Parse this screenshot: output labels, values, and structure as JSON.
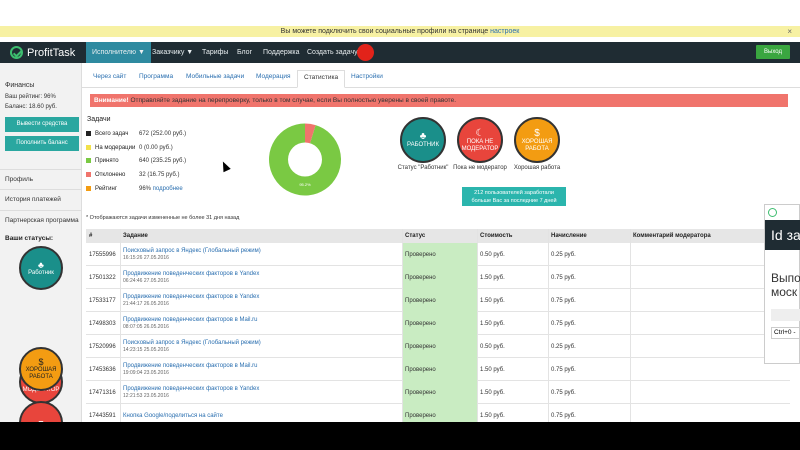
{
  "notice": {
    "text": "Вы можете подключить свои социальные профили на странице ",
    "link": "настроек",
    "close": "×"
  },
  "brand": {
    "name": "ProfitTask"
  },
  "nav": {
    "items": [
      "Исполнителю ▼",
      "Заказчику ▼",
      "Тарифы",
      "Блог",
      "Поддержка",
      "Создать задачу"
    ],
    "logout": "Выход"
  },
  "sidebar": {
    "finances": "Финансы",
    "rating": "Ваш рейтинг: 96%",
    "balance": "Баланс: 18.60 руб.",
    "withdraw": "Вывести средства",
    "topup": "Пополнить баланс",
    "links": [
      "Профиль",
      "История платежей",
      "Партнерская программа"
    ],
    "statuses_title": "Ваши статусы:",
    "statuses": [
      {
        "glyph": "♣",
        "label": "Работник"
      },
      {
        "glyph": "☾",
        "label": "ПОКА НЕ МОДЕРАТОР"
      },
      {
        "glyph": "$",
        "label": "ХОРОШАЯ РАБОТА"
      }
    ]
  },
  "tabs": [
    "Через сайт",
    "Программа",
    "Мобильные задачи",
    "Модерация",
    "Статистика",
    "Настройки"
  ],
  "alert": {
    "prefix": "Внимание!",
    "text": " Отправляйте задание на перепроверку, только в том случае, если Вы полностью уверены в своей правоте."
  },
  "stats": {
    "title": "Задачи",
    "rows": [
      {
        "label": "Всего задач",
        "value": "672 (252.00 руб.)",
        "color": "#222222"
      },
      {
        "label": "На модерации",
        "value": "0 (0.00 руб.)",
        "color": "#f2e14a"
      },
      {
        "label": "Принято",
        "value": "640 (235.25 руб.)",
        "color": "#7ac943"
      },
      {
        "label": "Отклонено",
        "value": "32 (16.75 руб.)",
        "color": "#f0746c"
      },
      {
        "label": "Рейтинг",
        "value": "96%",
        "sub": " подробнее",
        "color": "#f39c12"
      }
    ],
    "pie": {
      "accepted": 640,
      "rejected": 32,
      "label": "95.2%"
    }
  },
  "status_badges": [
    {
      "glyph": "♣",
      "text": "РАБОТНИК",
      "caption": "Статус \"Работник\""
    },
    {
      "glyph": "☾",
      "text": "ПОКА НЕ МОДЕРАТОР",
      "caption": "Пока не модератор"
    },
    {
      "glyph": "$",
      "text": "ХОРОШАЯ РАБОТА",
      "caption": "Хорошая работа"
    }
  ],
  "info": {
    "line1": "212 пользователей заработали",
    "line2": "больше Вас за последние 7 дней"
  },
  "footnote": "* Отображаются задачи измененные не более 31 дня назад",
  "table": {
    "headers": [
      "#",
      "Задание",
      "Статус",
      "Стоимость",
      "Начисление",
      "Комментарий модератора"
    ],
    "rows": [
      {
        "id": "17555996",
        "task": "Поисковый запрос в Яндекс (Глобальный режим)",
        "date": "16:15:26 27.05.2016",
        "status": "Проверено",
        "cost": "0.50 руб.",
        "credit": "0.25 руб."
      },
      {
        "id": "17501322",
        "task": "Продвижение поведенческих факторов в Yandex",
        "date": "06:24:46 27.05.2016",
        "status": "Проверено",
        "cost": "1.50 руб.",
        "credit": "0.75 руб."
      },
      {
        "id": "17533177",
        "task": "Продвижение поведенческих факторов в Yandex",
        "date": "21:44:17 26.05.2016",
        "status": "Проверено",
        "cost": "1.50 руб.",
        "credit": "0.75 руб."
      },
      {
        "id": "17498303",
        "task": "Продвижение поведенческих факторов в Mail.ru",
        "date": "08:07:05 26.05.2016",
        "status": "Проверено",
        "cost": "1.50 руб.",
        "credit": "0.75 руб."
      },
      {
        "id": "17520996",
        "task": "Поисковый запрос в Яндекс (Глобальный режим)",
        "date": "14:23:15 25.05.2016",
        "status": "Проверено",
        "cost": "0.50 руб.",
        "credit": "0.25 руб."
      },
      {
        "id": "17453636",
        "task": "Продвижение поведенческих факторов в Mail.ru",
        "date": "19:09:04 23.05.2016",
        "status": "Проверено",
        "cost": "1.50 руб.",
        "credit": "0.75 руб."
      },
      {
        "id": "17471316",
        "task": "Продвижение поведенческих факторов в Yandex",
        "date": "12:21:53 23.05.2016",
        "status": "Проверено",
        "cost": "1.50 руб.",
        "credit": "0.75 руб."
      },
      {
        "id": "17443591",
        "task": "Кнопка Google/поделиться на сайте",
        "date": "",
        "status": "Проверено",
        "cost": "1.50 руб.",
        "credit": "0.75 руб."
      }
    ]
  },
  "popup": {
    "title": "Id за",
    "text": "Выпо\nмоск",
    "hint": "Ctrl+0 -"
  }
}
